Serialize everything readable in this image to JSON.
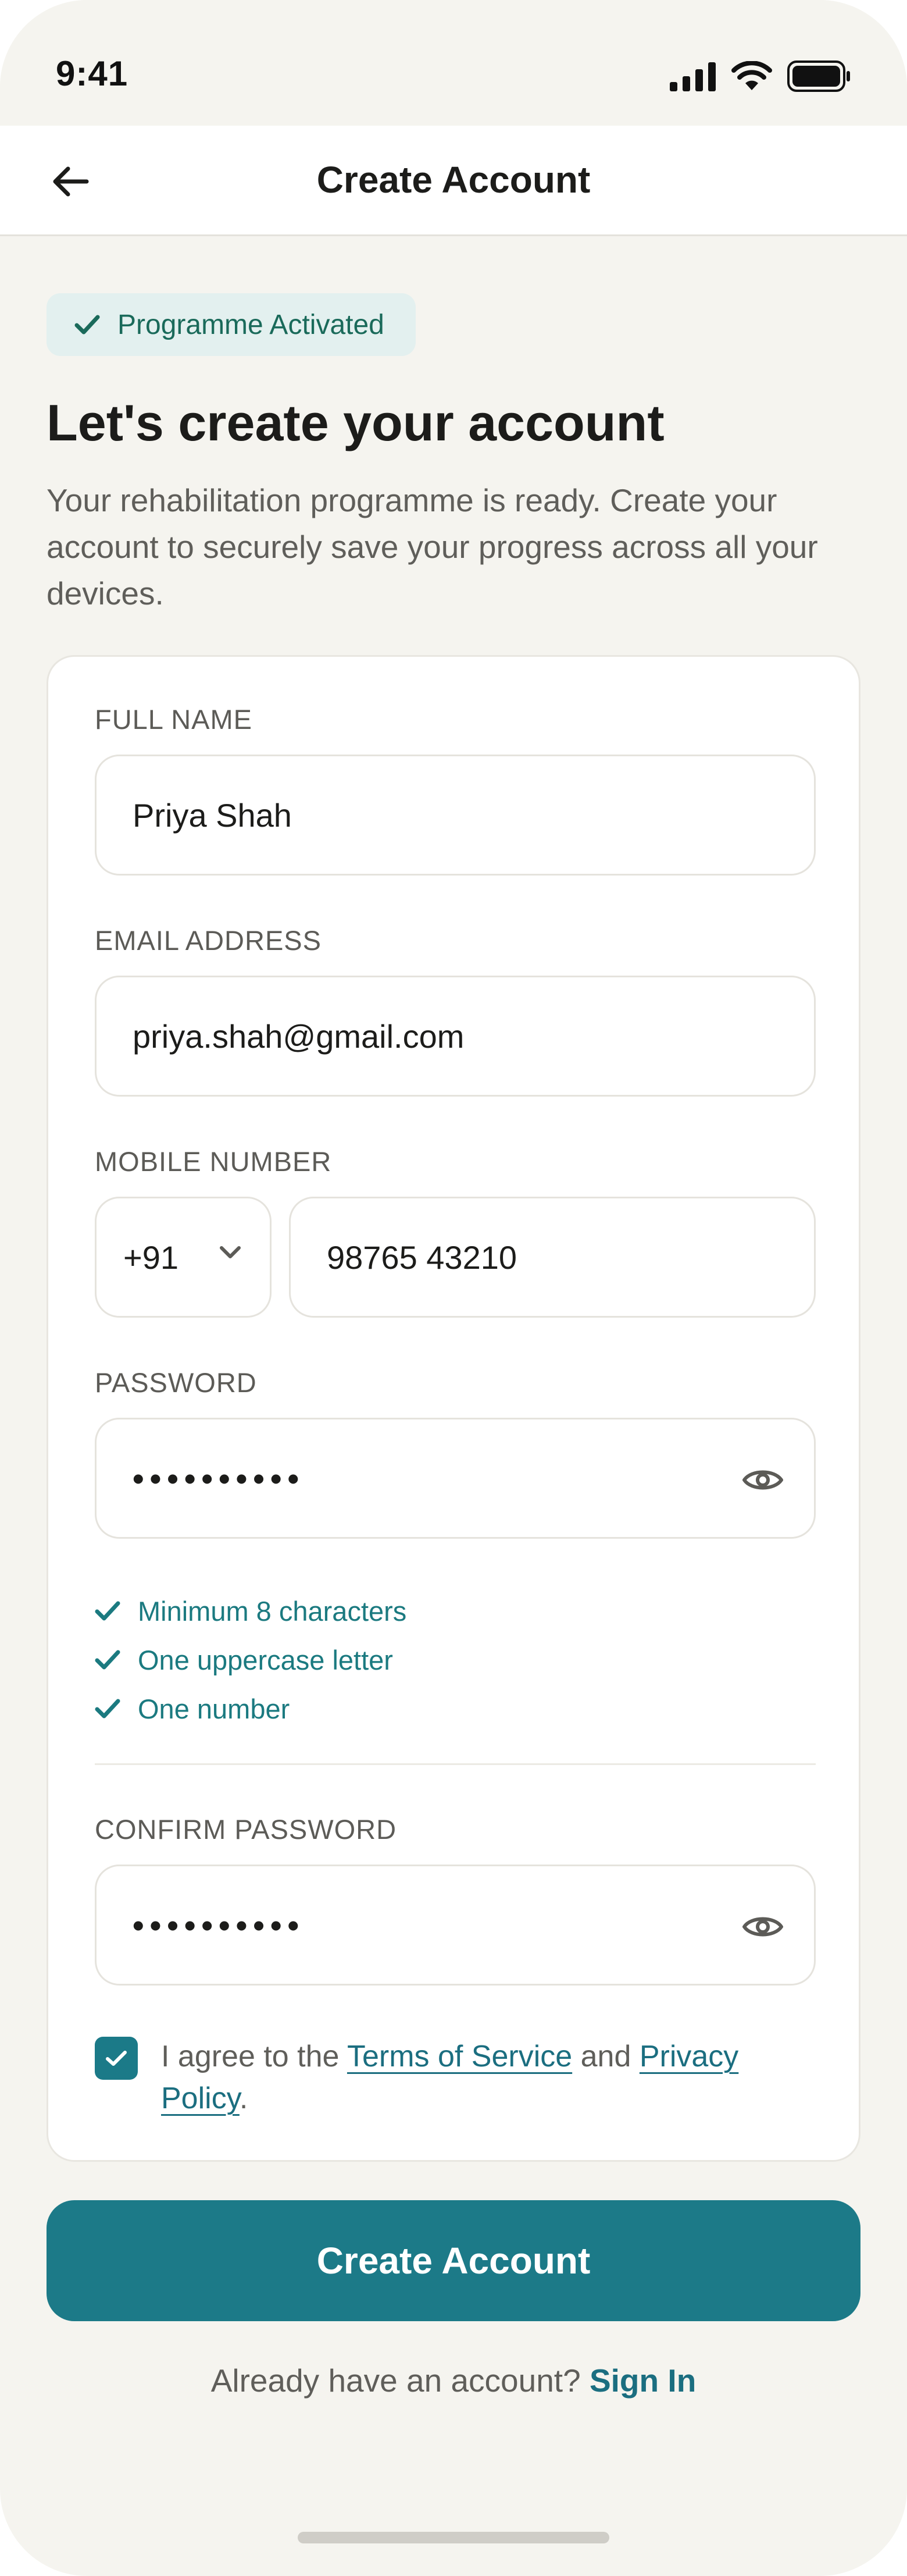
{
  "status_bar": {
    "time": "9:41"
  },
  "header": {
    "title": "Create Account"
  },
  "badge": {
    "label": "Programme Activated"
  },
  "intro": {
    "heading": "Let's create your account",
    "subtext": "Your rehabilitation programme is ready. Create your account to securely save your progress across all your devices."
  },
  "form": {
    "full_name": {
      "label": "FULL NAME",
      "value": "Priya Shah"
    },
    "email": {
      "label": "EMAIL ADDRESS",
      "value": "priya.shah@gmail.com"
    },
    "mobile": {
      "label": "MOBILE NUMBER",
      "country_code": "+91",
      "value": "98765 43210"
    },
    "password": {
      "label": "PASSWORD",
      "value": "••••••••••",
      "rules": [
        {
          "text": "Minimum 8 characters",
          "met": true
        },
        {
          "text": "One uppercase letter",
          "met": true
        },
        {
          "text": "One number",
          "met": true
        }
      ]
    },
    "confirm_password": {
      "label": "CONFIRM PASSWORD",
      "value": "••••••••••"
    },
    "agree": {
      "checked": true,
      "prefix": "I agree to the ",
      "terms_link": "Terms of Service",
      "middle": " and ",
      "privacy_link": "Privacy Policy",
      "suffix": "."
    }
  },
  "actions": {
    "primary_label": "Create Account",
    "signin_prompt": "Already have an account? ",
    "signin_link": "Sign In"
  },
  "colors": {
    "accent": "#1C7A88",
    "background": "#F5F4EF",
    "success": "#1A6A5A"
  }
}
